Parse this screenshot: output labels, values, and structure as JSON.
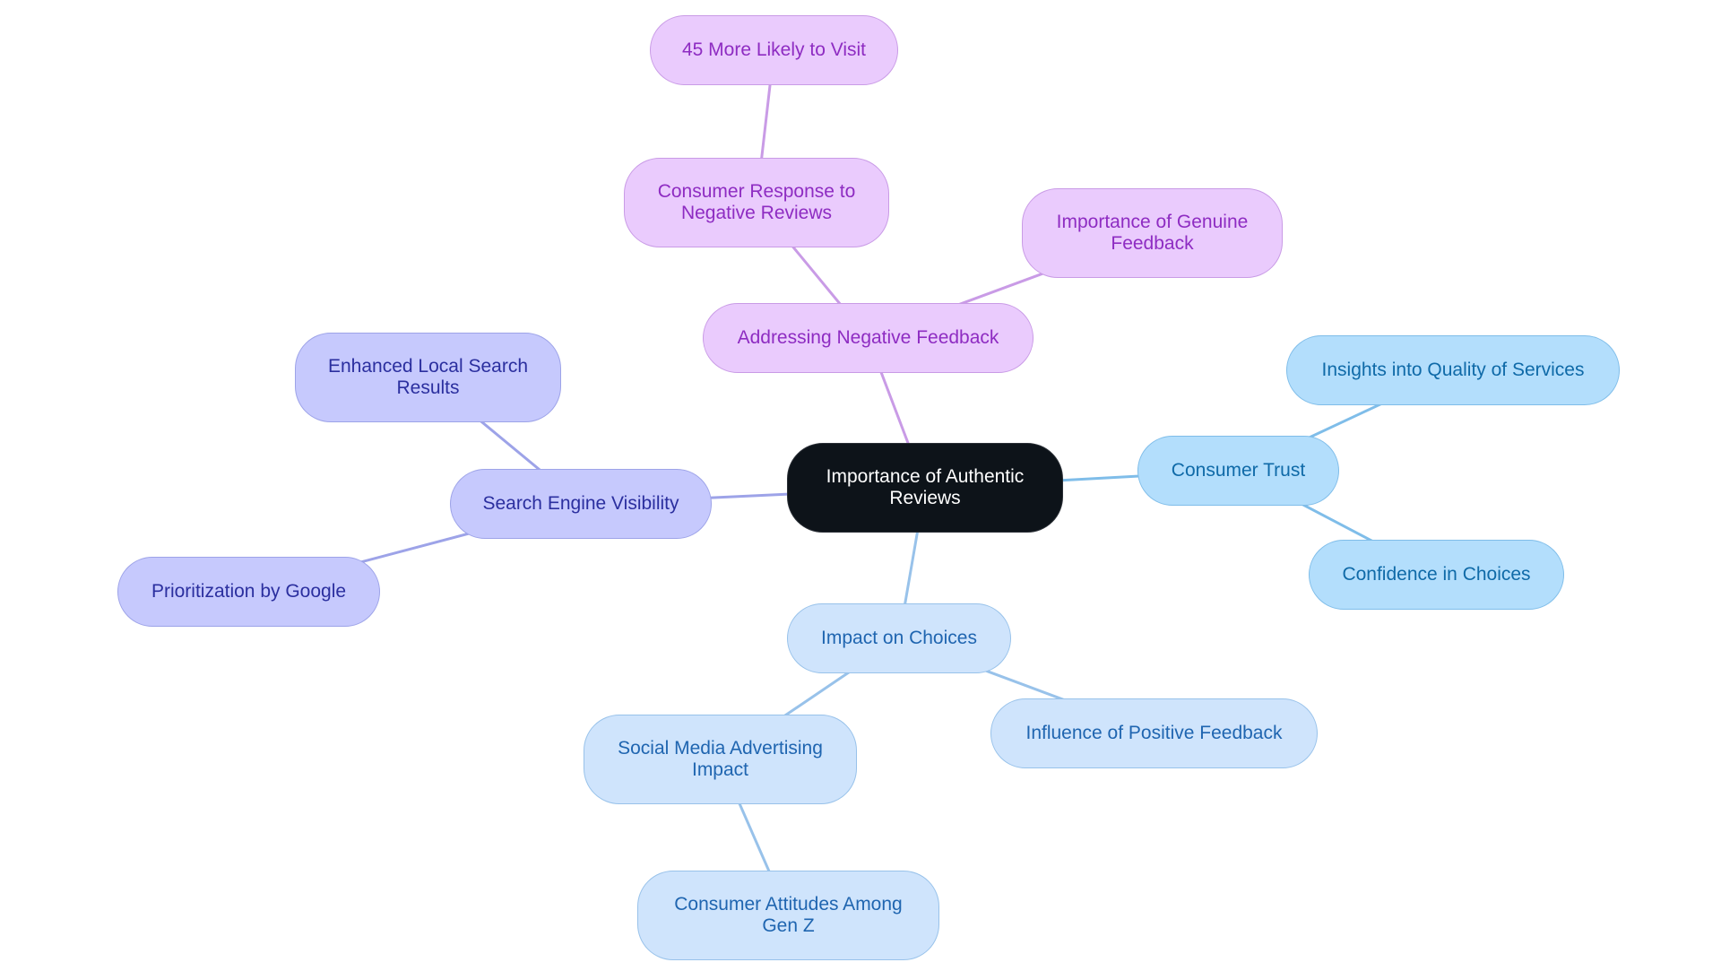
{
  "diagram": {
    "type": "mind-map",
    "root": {
      "id": "root",
      "label": "Importance of Authentic Reviews"
    },
    "nodes": [
      {
        "id": "addressing",
        "label": "Addressing Negative Feedback",
        "parent": "root",
        "branch": "purple"
      },
      {
        "id": "consumer-response",
        "label": "Consumer Response to Negative Reviews",
        "parent": "addressing",
        "branch": "purple"
      },
      {
        "id": "more-likely",
        "label": "45 More Likely to Visit",
        "parent": "consumer-response",
        "branch": "purple"
      },
      {
        "id": "genuine",
        "label": "Importance of Genuine Feedback",
        "parent": "addressing",
        "branch": "purple"
      },
      {
        "id": "search-engine",
        "label": "Search Engine Visibility",
        "parent": "root",
        "branch": "indigo"
      },
      {
        "id": "enhanced-local",
        "label": "Enhanced Local Search Results",
        "parent": "search-engine",
        "branch": "indigo"
      },
      {
        "id": "prioritization",
        "label": "Prioritization by Google",
        "parent": "search-engine",
        "branch": "indigo"
      },
      {
        "id": "consumer-trust",
        "label": "Consumer Trust",
        "parent": "root",
        "branch": "sky"
      },
      {
        "id": "insights",
        "label": "Insights into Quality of Services",
        "parent": "consumer-trust",
        "branch": "sky"
      },
      {
        "id": "confidence",
        "label": "Confidence in Choices",
        "parent": "consumer-trust",
        "branch": "sky"
      },
      {
        "id": "impact",
        "label": "Impact on Choices",
        "parent": "root",
        "branch": "pale"
      },
      {
        "id": "influence",
        "label": "Influence of Positive Feedback",
        "parent": "impact",
        "branch": "pale"
      },
      {
        "id": "social-media",
        "label": "Social Media Advertising Impact",
        "parent": "impact",
        "branch": "pale"
      },
      {
        "id": "gen-z",
        "label": "Consumer Attitudes Among Gen Z",
        "parent": "social-media",
        "branch": "pale"
      }
    ],
    "colors": {
      "root_fill": "#0d1319",
      "root_text": "#ffffff",
      "purple_fill": "#eacbfd",
      "purple_text": "#8e2cc2",
      "purple_edge": "#c99be6",
      "indigo_fill": "#c6c9fd",
      "indigo_text": "#2b2f9f",
      "indigo_edge": "#9da3e8",
      "sky_fill": "#b3defc",
      "sky_text": "#0f6aa8",
      "sky_edge": "#7fbde9",
      "pale_fill": "#cfe4fc",
      "pale_text": "#1f65b0",
      "pale_edge": "#98c2ea"
    }
  }
}
